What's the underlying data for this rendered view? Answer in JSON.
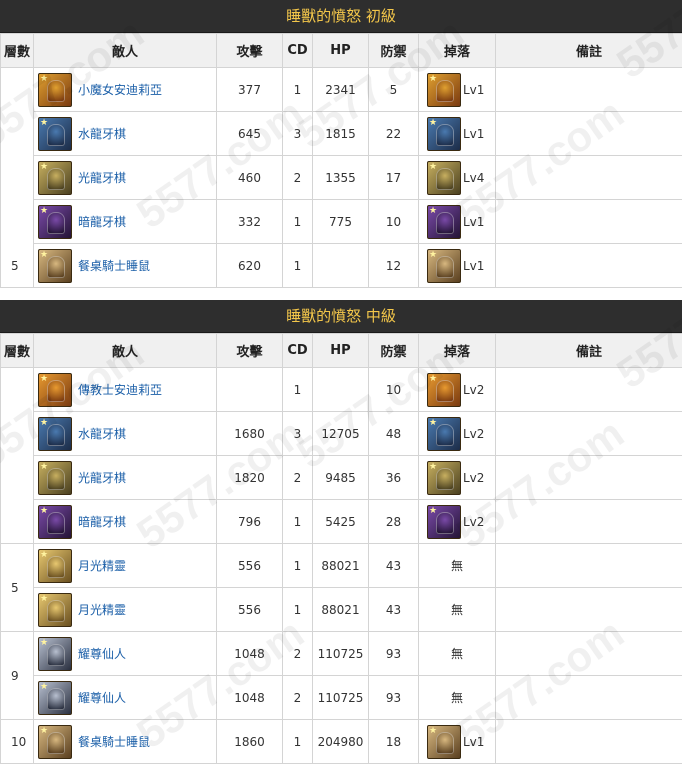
{
  "sections": [
    {
      "title": "睡獸的憤怒 初級",
      "headers": [
        "層數",
        "敵人",
        "攻擊",
        "CD",
        "HP",
        "防禦",
        "掉落",
        "備註"
      ],
      "rows": [
        {
          "floor": "",
          "enemy": "小魔女安迪莉亞",
          "icon": "witch-andrea-icon",
          "attack": "377",
          "cd": "1",
          "hp": "2341",
          "defense": "5",
          "drop": "Lv1",
          "drop_icon": "witch-andrea-icon"
        },
        {
          "floor": "",
          "enemy": "水龍牙棋",
          "icon": "water-dragon-knight-icon",
          "attack": "645",
          "cd": "3",
          "hp": "1815",
          "defense": "22",
          "drop": "Lv1",
          "drop_icon": "water-dragon-knight-icon"
        },
        {
          "floor": "",
          "enemy": "光龍牙棋",
          "icon": "light-dragon-knight-icon",
          "attack": "460",
          "cd": "2",
          "hp": "1355",
          "defense": "17",
          "drop": "Lv4",
          "drop_icon": "light-dragon-knight-icon"
        },
        {
          "floor": "",
          "enemy": "暗龍牙棋",
          "icon": "dark-dragon-knight-icon",
          "attack": "332",
          "cd": "1",
          "hp": "775",
          "defense": "10",
          "drop": "Lv1",
          "drop_icon": "dark-dragon-knight-icon"
        },
        {
          "floor": "5",
          "enemy": "餐桌騎士睡鼠",
          "icon": "dormouse-knight-icon",
          "attack": "620",
          "cd": "1",
          "hp": "",
          "defense": "12",
          "drop": "Lv1",
          "drop_icon": "dormouse-knight-icon"
        }
      ]
    },
    {
      "title": "睡獸的憤怒 中級",
      "headers": [
        "層數",
        "敵人",
        "攻擊",
        "CD",
        "HP",
        "防禦",
        "掉落",
        "備註"
      ],
      "rows": [
        {
          "floor": "",
          "enemy": "傳教士安迪莉亞",
          "icon": "missionary-andrea-icon",
          "attack": "",
          "cd": "1",
          "hp": "",
          "defense": "10",
          "drop": "Lv2",
          "drop_icon": "missionary-andrea-icon"
        },
        {
          "floor": "",
          "enemy": "水龍牙棋",
          "icon": "water-dragon-knight-icon",
          "attack": "1680",
          "cd": "3",
          "hp": "12705",
          "defense": "48",
          "drop": "Lv2",
          "drop_icon": "water-dragon-knight-icon"
        },
        {
          "floor": "",
          "enemy": "光龍牙棋",
          "icon": "light-dragon-knight-icon",
          "attack": "1820",
          "cd": "2",
          "hp": "9485",
          "defense": "36",
          "drop": "Lv2",
          "drop_icon": "light-dragon-knight-icon"
        },
        {
          "floor": "",
          "enemy": "暗龍牙棋",
          "icon": "dark-dragon-knight-icon",
          "attack": "796",
          "cd": "1",
          "hp": "5425",
          "defense": "28",
          "drop": "Lv2",
          "drop_icon": "dark-dragon-knight-icon"
        },
        {
          "floor": "5",
          "enemy": "月光精靈",
          "icon": "moonlight-spirit-icon",
          "attack": "556",
          "cd": "1",
          "hp": "88021",
          "defense": "43",
          "drop": "無",
          "drop_icon": ""
        },
        {
          "floor": "",
          "enemy": "月光精靈",
          "icon": "moonlight-spirit-icon",
          "attack": "556",
          "cd": "1",
          "hp": "88021",
          "defense": "43",
          "drop": "無",
          "drop_icon": ""
        },
        {
          "floor": "9",
          "enemy": "耀尊仙人",
          "icon": "glorious-immortal-icon",
          "attack": "1048",
          "cd": "2",
          "hp": "110725",
          "defense": "93",
          "drop": "無",
          "drop_icon": ""
        },
        {
          "floor": "",
          "enemy": "耀尊仙人",
          "icon": "glorious-immortal-icon",
          "attack": "1048",
          "cd": "2",
          "hp": "110725",
          "defense": "93",
          "drop": "無",
          "drop_icon": ""
        },
        {
          "floor": "10",
          "enemy": "餐桌騎士睡鼠",
          "icon": "dormouse-knight-icon",
          "attack": "1860",
          "cd": "1",
          "hp": "204980",
          "defense": "18",
          "drop": "Lv1",
          "drop_icon": "dormouse-knight-icon"
        }
      ]
    }
  ],
  "icon_colors": {
    "witch-andrea-icon": [
      "#e0a030",
      "#7a3a10"
    ],
    "missionary-andrea-icon": [
      "#e89a30",
      "#7a3a10"
    ],
    "water-dragon-knight-icon": [
      "#4a7ab0",
      "#1c2c48"
    ],
    "light-dragon-knight-icon": [
      "#c8b060",
      "#4a4020"
    ],
    "dark-dragon-knight-icon": [
      "#7a4aa8",
      "#241436"
    ],
    "dormouse-knight-icon": [
      "#d8b880",
      "#5a4020"
    ],
    "moonlight-spirit-icon": [
      "#e8c870",
      "#6a5020"
    ],
    "glorious-immortal-icon": [
      "#b8c0d0",
      "#2a3040"
    ]
  },
  "watermark": "5577.com",
  "colors": {
    "title_text": "#f3c64a",
    "title_bg": "#2e2e2e",
    "link": "#1b5fa8"
  }
}
